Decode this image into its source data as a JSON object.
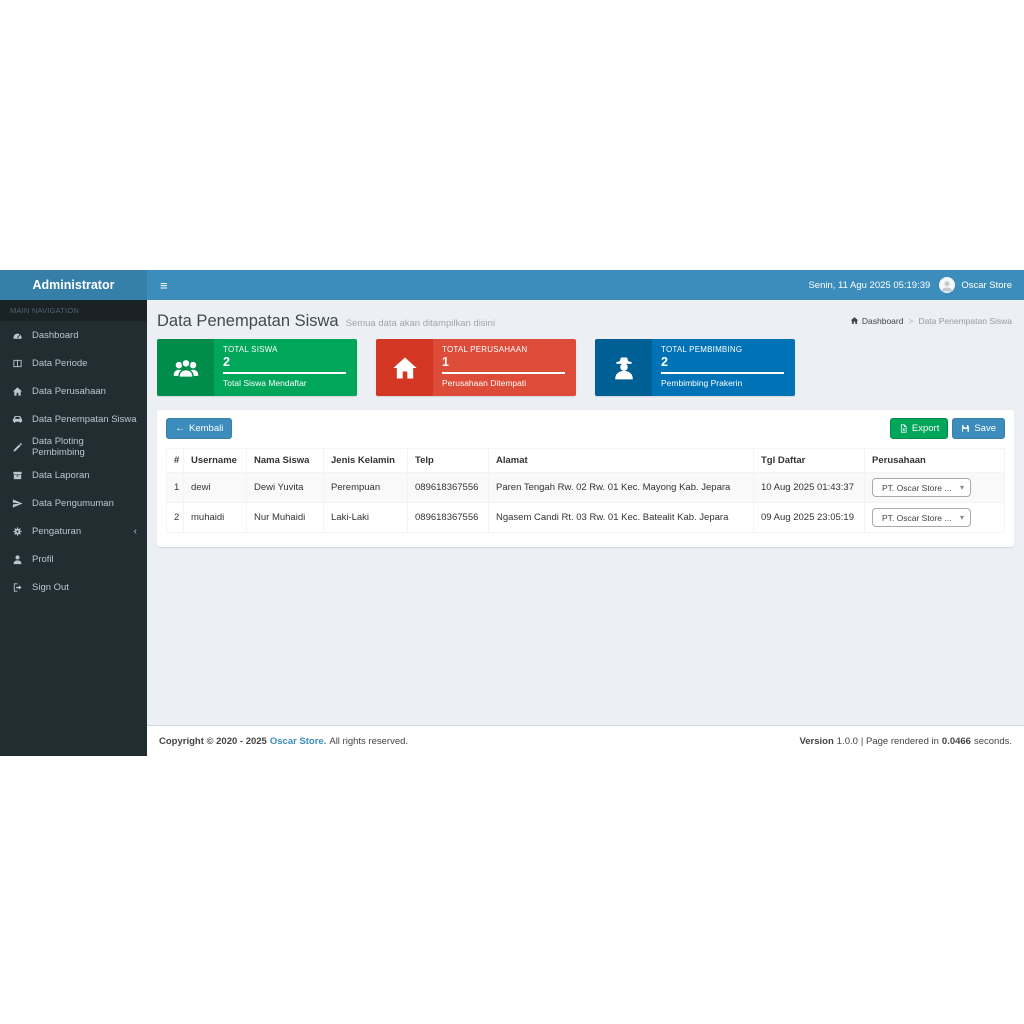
{
  "theme": {
    "navbar_blue": "#3c8dbc",
    "logo_blue": "#367fa9",
    "sidebar_dark": "#222d32",
    "content_bg": "#ecf0f5",
    "green": "#00a65a",
    "red": "#dd4b39",
    "blue": "#0073b7"
  },
  "navbar": {
    "brand": "Administrator",
    "menu_icon": "hamburger-icon",
    "datetime": "Senin, 11 Agu 2025 05:19:39",
    "user": "Oscar Store",
    "avatar_icon": "person-icon"
  },
  "sidebar": {
    "section_label": "MAIN NAVIGATION",
    "items": [
      {
        "label": "Dashboard",
        "icon": "dashboard-icon"
      },
      {
        "label": "Data Periode",
        "icon": "columns-icon"
      },
      {
        "label": "Data Perusahaan",
        "icon": "home-icon"
      },
      {
        "label": "Data Penempatan Siswa",
        "icon": "car-icon"
      },
      {
        "label": "Data Ploting Pembimbing",
        "icon": "pencil-icon"
      },
      {
        "label": "Data Laporan",
        "icon": "archive-icon"
      },
      {
        "label": "Data Pengumuman",
        "icon": "paper-plane-icon"
      },
      {
        "label": "Pengaturan",
        "icon": "gears-icon",
        "has_submenu": true,
        "chevron": "‹"
      },
      {
        "label": "Profil",
        "icon": "user-icon"
      },
      {
        "label": "Sign Out",
        "icon": "sign-out-icon"
      }
    ]
  },
  "page": {
    "title": "Data Penempatan Siswa",
    "subtitle": "Semua data akan ditampilkan disini",
    "breadcrumb": {
      "home": "Dashboard",
      "home_icon": "home-icon",
      "current": "Data Penempatan Siswa"
    }
  },
  "info_boxes": [
    {
      "label": "TOTAL SISWA",
      "value": "2",
      "description": "Total Siswa Mendaftar",
      "color": "#00a65a",
      "icon": "users-icon"
    },
    {
      "label": "TOTAL PERUSAHAAN",
      "value": "1",
      "description": "Perusahaan Ditempati",
      "color": "#dd4b39",
      "icon": "home-icon"
    },
    {
      "label": "TOTAL PEMBIMBING",
      "value": "2",
      "description": "Pembimbing Prakerin",
      "color": "#0073b7",
      "icon": "user-secret-icon"
    }
  ],
  "toolbar": {
    "back_label": "Kembali",
    "back_icon": "arrow-left-icon",
    "export_label": "Export",
    "export_icon": "file-excel-icon",
    "save_label": "Save",
    "save_icon": "floppy-icon"
  },
  "table": {
    "headers": [
      "#",
      "Username",
      "Nama Siswa",
      "Jenis Kelamin",
      "Telp",
      "Alamat",
      "Tgl Daftar",
      "Perusahaan"
    ],
    "rows": [
      {
        "num": "1",
        "username": "dewi",
        "nama_siswa": "Dewi Yuvita",
        "jenis_kelamin": "Perempuan",
        "telp": "089618367556",
        "alamat": "Paren Tengah Rw. 02 Rw. 01 Kec. Mayong Kab. Jepara",
        "tgl_daftar": "10 Aug 2025 01:43:37",
        "perusahaan": "PT. Oscar Store ..."
      },
      {
        "num": "2",
        "username": "muhaidi",
        "nama_siswa": "Nur Muhaidi",
        "jenis_kelamin": "Laki-Laki",
        "telp": "089618367556",
        "alamat": "Ngasem Candi Rt. 03 Rw. 01 Kec. Batealit Kab. Jepara",
        "tgl_daftar": "09 Aug 2025 23:05:19",
        "perusahaan": "PT. Oscar Store ..."
      }
    ]
  },
  "footer": {
    "copyright_bold": "Copyright © 2020 - 2025",
    "brand_link": "Oscar Store.",
    "copyright_rest": "All rights reserved.",
    "version_label": "Version",
    "version_value": "1.0.0",
    "rendered_prefix": "| Page rendered in",
    "rendered_value": "0.0466",
    "rendered_suffix": "seconds."
  }
}
